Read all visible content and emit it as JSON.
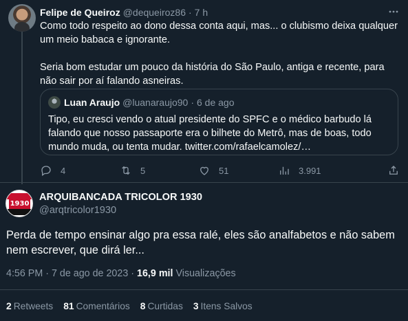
{
  "reply": {
    "display_name": "Felipe de Queiroz",
    "handle": "@dequeiroz86",
    "separator": "·",
    "time": "7 h",
    "paragraphs": [
      "Como todo respeito ao dono dessa conta aqui, mas... o clubismo deixa qualquer um meio babaca e ignorante.",
      "Seria bom estudar um pouco da história do São Paulo, antiga e recente, para não sair por aí falando asneiras."
    ],
    "quote": {
      "display_name": "Luan Araujo",
      "handle": "@luanaraujo90",
      "separator": "·",
      "time": "6 de ago",
      "text": "Tipo, eu cresci vendo o atual presidente do SPFC e o médico barbudo lá falando que nosso passaporte era o bilhete do Metrô, mas de boas, todo mundo muda, ou tenta mudar. twitter.com/rafaelcamolez/…"
    },
    "actions": {
      "replies": "4",
      "retweets": "5",
      "likes": "51",
      "views": "3.991"
    },
    "icons": [
      "more-icon",
      "reply-icon",
      "retweet-icon",
      "like-icon",
      "views-icon",
      "share-icon"
    ]
  },
  "main": {
    "display_name": "ARQUIBANCADA TRICOLOR 1930",
    "handle": "@arqtricolor1930",
    "avatar_text": "1930",
    "text": "Perda de tempo ensinar algo pra essa ralé, eles são analfabetos e não sabem nem escrever, que dirá ler...",
    "time": "4:56 PM",
    "separator": "·",
    "date": "7 de ago de 2023",
    "views_count": "16,9 mil",
    "views_label": "Visualizações",
    "stats": [
      {
        "count": "2",
        "label": "Retweets"
      },
      {
        "count": "81",
        "label": "Comentários"
      },
      {
        "count": "8",
        "label": "Curtidas"
      },
      {
        "count": "3",
        "label": "Itens Salvos"
      }
    ]
  },
  "colors": {
    "background": "#15202b",
    "text": "#f7f9f9",
    "muted": "#8b98a5",
    "border": "#38444d"
  }
}
